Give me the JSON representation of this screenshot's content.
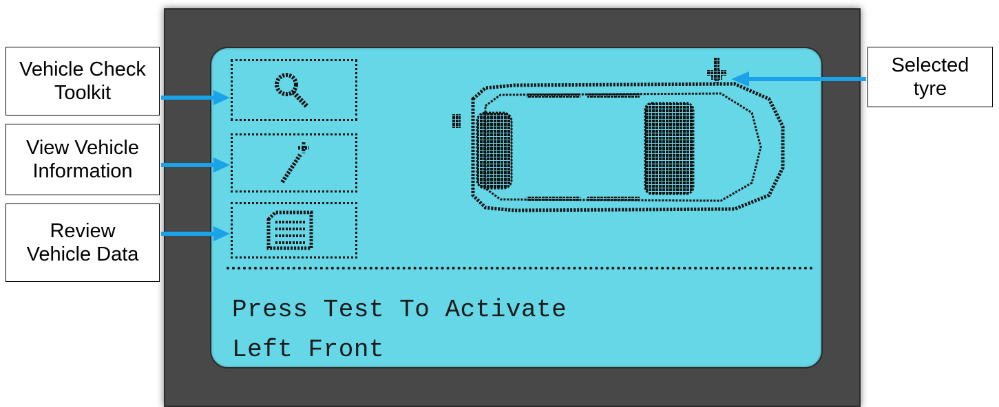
{
  "screen": {
    "line1": "Press Test To Activate",
    "line2": "Left Front"
  },
  "icons": [
    {
      "name": "magnifier-icon"
    },
    {
      "name": "wand-icon"
    },
    {
      "name": "document-list-icon"
    }
  ],
  "callouts": {
    "check_toolkit": "Vehicle Check\nToolkit",
    "view_info": "View Vehicle\nInformation",
    "review_data": "Review\nVehicle Data",
    "selected_tyre": "Selected\ntyre"
  },
  "colors": {
    "lcd_background": "#66d7e7",
    "device_bezel": "#484848",
    "arrow": "#1aa3e8",
    "pixel": "#111111"
  }
}
